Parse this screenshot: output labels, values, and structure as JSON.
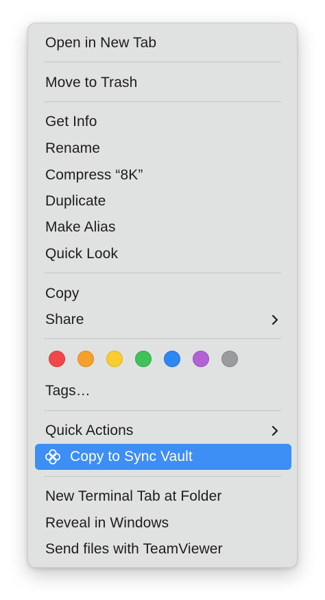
{
  "menu": {
    "group1": [
      {
        "label": "Open in New Tab"
      }
    ],
    "group2": [
      {
        "label": "Move to Trash"
      }
    ],
    "group3": [
      {
        "label": "Get Info"
      },
      {
        "label": "Rename"
      },
      {
        "label": "Compress “8K”"
      },
      {
        "label": "Duplicate"
      },
      {
        "label": "Make Alias"
      },
      {
        "label": "Quick Look"
      }
    ],
    "group4": [
      {
        "label": "Copy"
      },
      {
        "label": "Share",
        "submenu": true
      }
    ],
    "tags": {
      "colors": [
        {
          "name": "red",
          "fill": "#f0484a",
          "border": "#d73a3c"
        },
        {
          "name": "orange",
          "fill": "#f5a02c",
          "border": "#dd8a1c"
        },
        {
          "name": "yellow",
          "fill": "#f7cd2f",
          "border": "#ddb31f"
        },
        {
          "name": "green",
          "fill": "#3fc259",
          "border": "#2fa747"
        },
        {
          "name": "blue",
          "fill": "#2f86f5",
          "border": "#1f70d8"
        },
        {
          "name": "purple",
          "fill": "#b163d6",
          "border": "#9a50bf"
        },
        {
          "name": "gray",
          "fill": "#9a9b9d",
          "border": "#838486"
        }
      ],
      "label": "Tags…"
    },
    "group5": [
      {
        "label": "Quick Actions",
        "submenu": true
      },
      {
        "label": "Copy to Sync Vault",
        "icon": "sync-vault-icon",
        "highlighted": true
      }
    ],
    "group6": [
      {
        "label": "New Terminal Tab at Folder"
      },
      {
        "label": "Reveal in Windows"
      },
      {
        "label": "Send files with TeamViewer"
      }
    ],
    "highlight_color": "#3d8ef5"
  }
}
